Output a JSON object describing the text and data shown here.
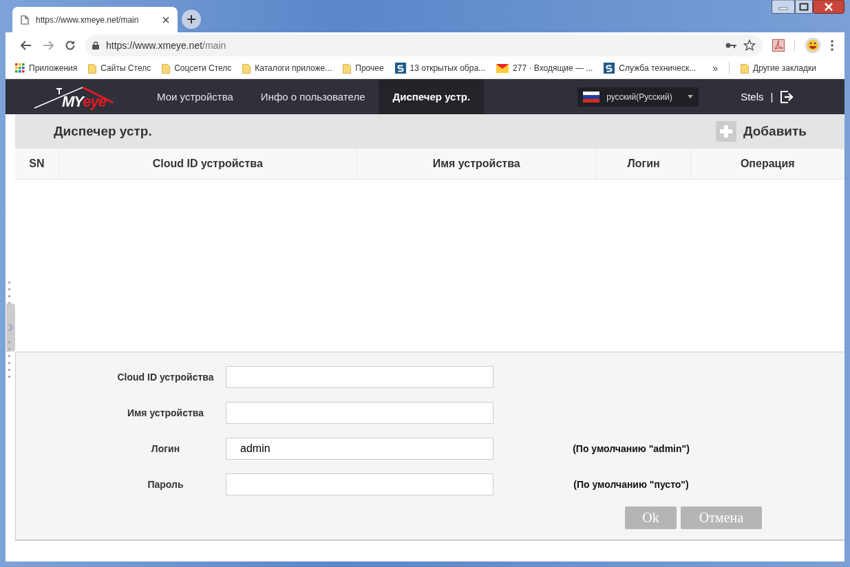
{
  "browser": {
    "tab": {
      "title": "https://www.xmeye.net/main"
    },
    "address": {
      "host": "https://www.xmeye.net",
      "path": "/main"
    },
    "bookmarks": [
      {
        "kind": "apps",
        "label": "Приложения"
      },
      {
        "kind": "folder",
        "label": "Сайты Стелс"
      },
      {
        "kind": "folder",
        "label": "Соцсети Стелс"
      },
      {
        "kind": "folder",
        "label": "Каталоги приложе..."
      },
      {
        "kind": "folder",
        "label": "Прочее"
      },
      {
        "kind": "site",
        "label": "13 открытых обра..."
      },
      {
        "kind": "mail",
        "label": "277 · Входящие — ..."
      },
      {
        "kind": "site",
        "label": "Служба техническ..."
      }
    ],
    "overflow": "»",
    "other_bookmarks": "Другие закладки"
  },
  "nav": {
    "logo": {
      "main": "MY",
      "accent": "eye"
    },
    "tabs": [
      {
        "label": "Мои устройства",
        "selected": false
      },
      {
        "label": "Инфо о пользователе",
        "selected": false
      },
      {
        "label": "Диспечер устр.",
        "selected": true
      }
    ],
    "language": "русский(Русский)",
    "user": "Stels",
    "separator": "|"
  },
  "panel": {
    "title": "Диспечер устр.",
    "add_button": "Добавить"
  },
  "table": {
    "columns": [
      "SN",
      "Cloud ID устройства",
      "Имя устройства",
      "Логин",
      "Операция"
    ]
  },
  "form": {
    "fields": [
      {
        "label": "Cloud ID устройства"
      },
      {
        "label": "Имя устройства"
      },
      {
        "label": "Логин",
        "value": "admin",
        "hint": "(По умолчанию \"admin\")"
      },
      {
        "label": "Пароль",
        "hint": "(По умолчанию \"пусто\")"
      }
    ],
    "buttons": [
      "Ok",
      "Отмена"
    ]
  }
}
